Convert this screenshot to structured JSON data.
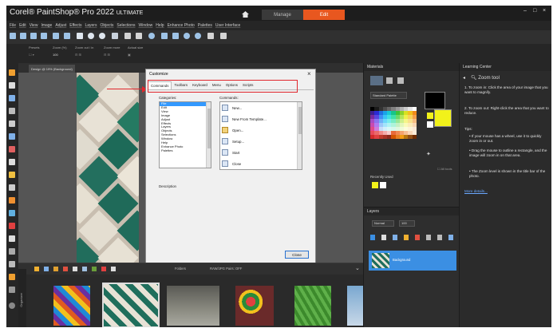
{
  "app": {
    "title_main": "Corel® PaintShop® Pro 2022",
    "title_edition": "ULTIMATE",
    "tabs": [
      "Manage",
      "Edit"
    ],
    "active_tab": "Edit",
    "window_controls": [
      "–",
      "□",
      "×"
    ]
  },
  "menu": [
    "File",
    "Edit",
    "View",
    "Image",
    "Adjust",
    "Effects",
    "Layers",
    "Objects",
    "Selections",
    "Window",
    "Help",
    "Enhance Photo",
    "Palettes",
    "User Interface"
  ],
  "tool_options": {
    "labels": [
      "Presets",
      "Zoom (%)",
      "Zoom out / in",
      "Zoom more",
      "Actual size"
    ],
    "zoom_value": "100"
  },
  "document": {
    "tab_label": "Design @ 19% (Background)"
  },
  "dialog": {
    "title": "Customize",
    "close": "×",
    "tabs": [
      "Commands",
      "Toolbars",
      "Keyboard",
      "Menu",
      "Options",
      "Scripts"
    ],
    "active_tab": "Commands",
    "categories_label": "Categories:",
    "commands_label": "Commands:",
    "categories": [
      "File",
      "Edit",
      "View",
      "Image",
      "Adjust",
      "Effects",
      "Layers",
      "Objects",
      "Selections",
      "Window",
      "Help",
      "Enhance Photo",
      "Palettes"
    ],
    "selected_category": "File",
    "commands": [
      "New...",
      "New From Template...",
      "Open...",
      "Setup...",
      "Start",
      "Close"
    ],
    "description_label": "Description",
    "close_button": "Close"
  },
  "organizer": {
    "folder_label": "Folders",
    "filter_label": "RAW/JPG Pairs: OFF",
    "side_label": "Organizer"
  },
  "materials": {
    "title": "Materials",
    "palette_dropdown": "Standard Palette",
    "recently_used_label": "Recently Used",
    "palette_colors": [
      "#000000",
      "#1a1a1a",
      "#333333",
      "#4d4d4d",
      "#666666",
      "#808080",
      "#999999",
      "#b3b3b3",
      "#cccccc",
      "#e6e6e6",
      "#ffffff",
      "#3b1f8f",
      "#2b2bd4",
      "#1f6fe0",
      "#1aa3e8",
      "#18c9d4",
      "#17c48a",
      "#3cc43a",
      "#8ad12c",
      "#d8e021",
      "#f2c01d",
      "#ef8a1a",
      "#7a2a9e",
      "#5a46e0",
      "#3f8ef2",
      "#38c4f5",
      "#41e0e0",
      "#3fe0a8",
      "#6ad86a",
      "#b4e45a",
      "#eef04a",
      "#f7d25a",
      "#f4a04a",
      "#a64ac4",
      "#8a74ef",
      "#6fb0f7",
      "#6cd7fa",
      "#7aecec",
      "#78ebc3",
      "#98e698",
      "#cdef8c",
      "#f5f58a",
      "#f9e08c",
      "#f7bd82",
      "#c84ab0",
      "#b07af0",
      "#9ec6f8",
      "#a2e4fb",
      "#aef3f3",
      "#aef3da",
      "#c3f0c3",
      "#e3f6ba",
      "#fafab8",
      "#fcecb8",
      "#fad6b2",
      "#e04a8a",
      "#d07adb",
      "#c7ddfa",
      "#d1f0fc",
      "#d8f8f8",
      "#d6f8ec",
      "#e0f7e0",
      "#f0fbd8",
      "#fdfdda",
      "#fdf4d8",
      "#fce9d6",
      "#e84a5a",
      "#ea6a6a",
      "#f08a8a",
      "#f4aaaa",
      "#f7caca",
      "#e86a3a",
      "#f08850",
      "#f4a470",
      "#f7c094",
      "#fad8b8",
      "#fcecd8",
      "#d22a2a",
      "#e04040",
      "#c0392b",
      "#a93226",
      "#8e2b1f",
      "#d35400",
      "#e67e22",
      "#f39c12",
      "#b9770e",
      "#935116",
      "#6e2c00"
    ],
    "fg_color": "#000000",
    "bg_color": "#f2f21a",
    "recent_colors": [
      "#f2f21a",
      "#ffffff"
    ]
  },
  "layers": {
    "title": "Layers",
    "blend_mode": "Normal",
    "opacity": "100",
    "layer_name": "Background"
  },
  "learning_center": {
    "title": "Learning Center",
    "tool_title": "Zoom tool",
    "steps": [
      "1. To zoom in: Click the area of your image that you want to magnify.",
      "2. To zoom out: Right-click the area that you want to reduce."
    ],
    "tips_label": "Tips:",
    "tips": [
      "If your mouse has a wheel, use it to quickly zoom in or out.",
      "Drag the mouse to outline a rectangle, and the image will zoom in on that area.",
      "The Zoom level is shown in the title bar of the photo."
    ],
    "more_link": "More details..."
  }
}
